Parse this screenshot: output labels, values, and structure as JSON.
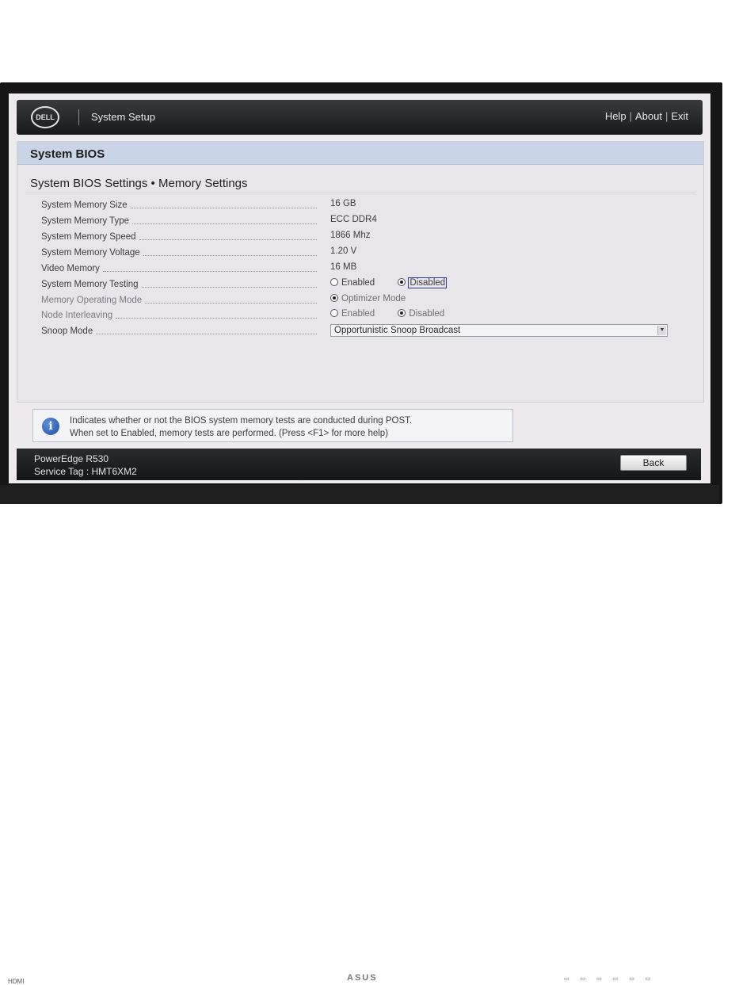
{
  "monitor": {
    "brand": "ASUS",
    "port": "HDMI"
  },
  "header": {
    "logo": "DELL",
    "title": "System Setup",
    "links": [
      "Help",
      "About",
      "Exit"
    ]
  },
  "section": {
    "title": "System BIOS",
    "subtitle": "System BIOS Settings • Memory Settings"
  },
  "settings": [
    {
      "label": "System Memory Size",
      "value": "16 GB"
    },
    {
      "label": "System Memory Type",
      "value": "ECC DDR4"
    },
    {
      "label": "System Memory Speed",
      "value": "1866 Mhz"
    },
    {
      "label": "System Memory Voltage",
      "value": "1.20 V"
    },
    {
      "label": "Video Memory",
      "value": "16 MB"
    },
    {
      "label": "System Memory Testing",
      "options": [
        "Enabled",
        "Disabled"
      ],
      "selected": "Disabled"
    },
    {
      "label": "Memory Operating Mode",
      "options": [
        "Optimizer Mode"
      ],
      "selected": "Optimizer Mode",
      "disabled": true
    },
    {
      "label": "Node Interleaving",
      "options": [
        "Enabled",
        "Disabled"
      ],
      "selected": "Disabled",
      "disabled": true
    },
    {
      "label": "Snoop Mode",
      "dropdown_value": "Opportunistic Snoop Broadcast"
    }
  ],
  "help": {
    "icon": "info-icon",
    "line1": "Indicates whether or not the BIOS system memory tests are conducted during POST.",
    "line2": "When set to Enabled, memory tests are performed. (Press <F1> for more help)"
  },
  "footer": {
    "model": "PowerEdge R530",
    "service_tag": "Service Tag : HMT6XM2",
    "back_label": "Back"
  },
  "colors": {
    "header_bg": "#1c1d20",
    "section_bg": "#c9d5e6",
    "screen_bg": "#eeebef",
    "info_icon": "#2a5cb8"
  }
}
